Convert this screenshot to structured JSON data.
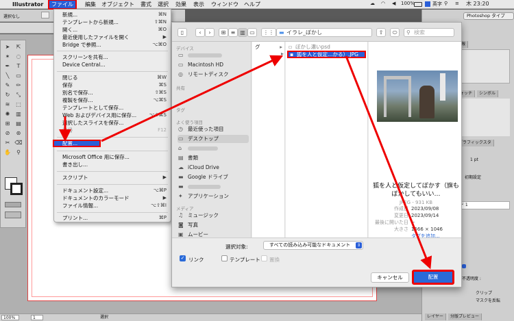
{
  "menubar": {
    "app": "Illustrator",
    "items": [
      "ファイル",
      "編集",
      "オブジェクト",
      "書式",
      "選択",
      "効果",
      "表示",
      "ウィンドウ",
      "ヘルプ"
    ],
    "status": {
      "battery": "100%",
      "input": "英字",
      "clock": "木 23:20"
    }
  },
  "toolbar": {
    "selection": "選択なし",
    "workspace": "Photoshop タイプ"
  },
  "file_menu": {
    "items": [
      {
        "label": "新規...",
        "shortcut": "⌘N"
      },
      {
        "label": "テンプレートから新規...",
        "shortcut": "⇧⌘N"
      },
      {
        "label": "開く...",
        "shortcut": "⌘O"
      },
      {
        "label": "最近使用したファイルを開く",
        "shortcut": "▶"
      },
      {
        "label": "Bridge で参照...",
        "shortcut": "⌥⌘O"
      },
      {
        "label": "スクリーンを共有...",
        "shortcut": ""
      },
      {
        "label": "Device Central...",
        "shortcut": ""
      },
      {
        "label": "閉じる",
        "shortcut": "⌘W"
      },
      {
        "label": "保存",
        "shortcut": "⌘S"
      },
      {
        "label": "別名で保存...",
        "shortcut": "⇧⌘S"
      },
      {
        "label": "複製を保存...",
        "shortcut": "⌥⌘S"
      },
      {
        "label": "テンプレートとして保存...",
        "shortcut": ""
      },
      {
        "label": "Web およびデバイス用に保存...",
        "shortcut": "⌥⇧⌘S"
      },
      {
        "label": "選択したスライスを保存...",
        "shortcut": ""
      },
      {
        "label": "復帰",
        "shortcut": "F12"
      },
      {
        "label": "配置...",
        "shortcut": ""
      },
      {
        "label": "Microsoft Office 用に保存...",
        "shortcut": ""
      },
      {
        "label": "書き出し...",
        "shortcut": ""
      },
      {
        "label": "スクリプト",
        "shortcut": "▶"
      },
      {
        "label": "ドキュメント設定...",
        "shortcut": "⌥⌘P"
      },
      {
        "label": "ドキュメントのカラーモード",
        "shortcut": "▶"
      },
      {
        "label": "ファイル情報...",
        "shortcut": "⌥⇧⌘I"
      },
      {
        "label": "プリント...",
        "shortcut": "⌘P"
      }
    ]
  },
  "dialog": {
    "folder": "イラレ_ぼかし",
    "search_placeholder": "検索",
    "sidebar": {
      "devices_header": "デバイス",
      "devices": [
        "",
        "Macintosh HD",
        "リモートディスク"
      ],
      "shared_header": "共有",
      "tags_header": "タグ",
      "fav_header": "よく使う項目",
      "favorites": [
        "最近使った項目",
        "デスクトップ",
        "",
        "書類",
        "iCloud Drive",
        "Google ドライブ",
        "",
        "アプリケーション"
      ],
      "media_header": "メディア",
      "media": [
        "ミュージック",
        "写真",
        "ムービー"
      ]
    },
    "col1": [
      "グ"
    ],
    "files": [
      "ぼかし濃いpsd",
      "狐を人と仮定…かる）.JPG"
    ],
    "preview": {
      "title": "狐を人と仮定してぼかす（旗もぼかしてもいい…",
      "kind": "JPEG - 931 KB",
      "rows": [
        {
          "k": "作成日",
          "v": "2023/09/08"
        },
        {
          "k": "変更日",
          "v": "2023/09/14"
        },
        {
          "k": "最後に開いた日",
          "v": "--"
        },
        {
          "k": "大きさ",
          "v": "1566 × 1046"
        }
      ],
      "tag_link": "タグを追加..."
    },
    "enable_label": "選択対象:",
    "enable_value": "すべての読み込み可能なドキュメント",
    "link_label": "リンク",
    "template_label": "テンプレート",
    "replace_label": "置換",
    "cancel": "キャンセル",
    "place": "配置"
  },
  "right_panels": {
    "tabs": [
      "情報",
      "スウォッチ",
      "シンボル",
      "グラフィックスタ"
    ],
    "stroke": "1 pt",
    "initial": "初期設定",
    "layer_name": "ード 1",
    "opacity_label": "不透明度 :",
    "clip": "クリップ",
    "mask": "マスクを反転",
    "layer_tab": "レイヤー",
    "preview_tab": "分版プレビュー"
  },
  "status": {
    "zoom": "100%",
    "page": "1",
    "mode": "選択"
  }
}
